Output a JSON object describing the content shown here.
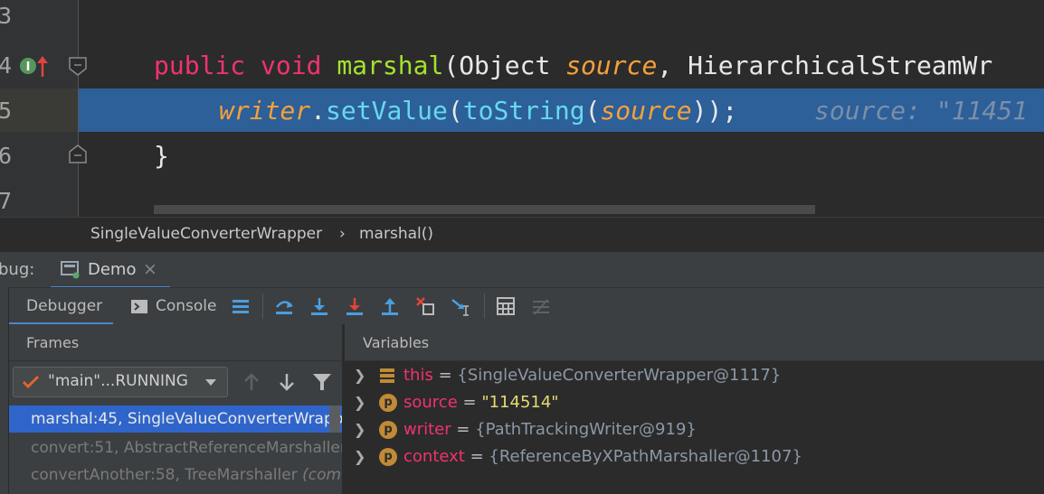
{
  "editor": {
    "line_numbers": [
      "3",
      "4",
      "5",
      "6",
      "7"
    ],
    "line4": {
      "kw_public": "public",
      "kw_void": "void",
      "method": "marshal",
      "open": "(",
      "type1": "Object ",
      "param1": "source",
      "sep": ", ",
      "type2": "HierarchicalStreamWr"
    },
    "line5": {
      "field": "writer",
      "dot": ".",
      "call1": "setValue",
      "p1": "(",
      "call2": "toString",
      "p2": "(",
      "arg": "source",
      "close": "));",
      "hint": "source: \"11451"
    },
    "line6": "}"
  },
  "breadcrumb": {
    "class": "SingleValueConverterWrapper",
    "sep": "›",
    "method": "marshal()"
  },
  "debug": {
    "label": "bug:",
    "session_tab": "Demo",
    "close_glyph": "×"
  },
  "toolbar": {
    "tab_debugger": "Debugger",
    "tab_console": "Console"
  },
  "frames": {
    "header": "Frames",
    "thread": "\"main\"...RUNNING",
    "items": [
      {
        "text": "marshal:45, SingleValueConverterWrapp"
      },
      {
        "text": "convert:51, AbstractReferenceMarshaller"
      },
      {
        "text": "convertAnother:58, TreeMarshaller",
        "suffix": "(com"
      }
    ]
  },
  "variables": {
    "header": "Variables",
    "items": [
      {
        "name": "this",
        "eq": " = ",
        "value": "{SingleValueConverterWrapper@1117}"
      },
      {
        "name": "source",
        "eq": " = ",
        "value": "\"114514\""
      },
      {
        "name": "writer",
        "eq": " = ",
        "value": "{PathTrackingWriter@919}"
      },
      {
        "name": "context",
        "eq": " = ",
        "value": "{ReferenceByXPathMarshaller@1107}"
      }
    ]
  },
  "colors": {
    "selection": "#2d5f99",
    "keyword": "#f0336d",
    "method": "#a6e22e",
    "param": "#f6a13a",
    "string": "#e6db74"
  }
}
